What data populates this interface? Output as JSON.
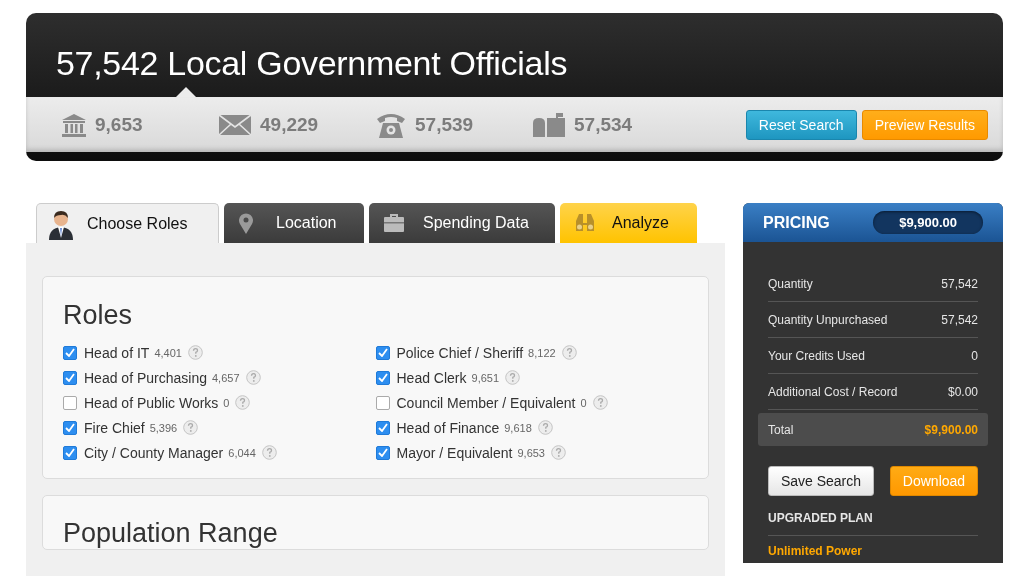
{
  "header": {
    "title": "57,542 Local Government Officials",
    "stats": [
      {
        "kind": "address",
        "value": "9,653"
      },
      {
        "kind": "email",
        "value": "49,229"
      },
      {
        "kind": "phone",
        "value": "57,539"
      },
      {
        "kind": "mail",
        "value": "57,534"
      }
    ],
    "buttons": [
      {
        "kind": "reset",
        "label": "Reset Search"
      },
      {
        "kind": "preview",
        "label": "Preview Results"
      }
    ]
  },
  "tabs": [
    {
      "label": "Choose Roles",
      "kind": "person",
      "selected": true
    },
    {
      "label": "Location",
      "kind": "pin",
      "selected": false
    },
    {
      "label": "Spending Data",
      "kind": "briefcase",
      "selected": false
    },
    {
      "label": "Analyze",
      "kind": "binoculars",
      "selected": false
    }
  ],
  "roles": {
    "title": "Roles",
    "items": [
      {
        "label": "Head of IT",
        "count": "4,401",
        "checked": true
      },
      {
        "label": "Head of Purchasing",
        "count": "4,657",
        "checked": true
      },
      {
        "label": "Head of Public Works",
        "count": "0",
        "checked": false
      },
      {
        "label": "Fire Chief",
        "count": "5,396",
        "checked": true
      },
      {
        "label": "City / County Manager",
        "count": "6,044",
        "checked": true
      },
      {
        "label": "Police Chief / Sheriff",
        "count": "8,122",
        "checked": true
      },
      {
        "label": "Head Clerk",
        "count": "9,651",
        "checked": true
      },
      {
        "label": "Council Member / Equivalent",
        "count": "0",
        "checked": false
      },
      {
        "label": "Head of Finance",
        "count": "9,618",
        "checked": true
      },
      {
        "label": "Mayor / Equivalent",
        "count": "9,653",
        "checked": true
      }
    ]
  },
  "population": {
    "title": "Population Range"
  },
  "pricing": {
    "title": "PRICING",
    "price": "$9,900.00",
    "rows": [
      {
        "label": "Quantity",
        "value": "57,542"
      },
      {
        "label": "Quantity Unpurchased",
        "value": "57,542"
      },
      {
        "label": "Your Credits Used",
        "value": "0"
      },
      {
        "label": "Additional Cost / Record",
        "value": "$0.00"
      }
    ],
    "total": {
      "label": "Total",
      "value": "$9,900.00"
    },
    "buttons": [
      {
        "kind": "save",
        "label": "Save Search"
      },
      {
        "kind": "download",
        "label": "Download"
      }
    ],
    "plan_title": "UPGRADED PLAN",
    "plan_name": "Unlimited Power"
  }
}
